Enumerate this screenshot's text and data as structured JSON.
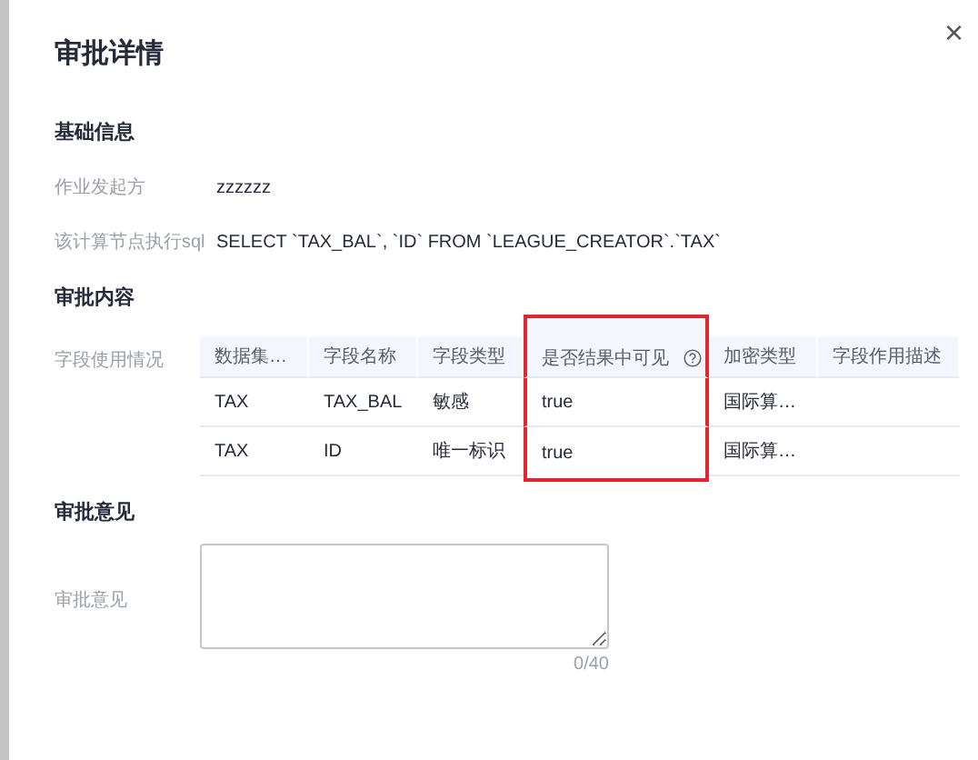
{
  "dialog": {
    "title": "审批详情",
    "close": "×"
  },
  "basic_info": {
    "heading": "基础信息",
    "fields": [
      {
        "label": "作业发起方",
        "value": "zzzzzz"
      },
      {
        "label": "该计算节点执行sql",
        "value": "SELECT `TAX_BAL`, `ID` FROM `LEAGUE_CREATOR`.`TAX`"
      }
    ]
  },
  "approval_content": {
    "heading": "审批内容",
    "label": "字段使用情况",
    "table": {
      "columns": [
        {
          "label": "数据集…",
          "highlighted": false,
          "help": false
        },
        {
          "label": "字段名称",
          "highlighted": false,
          "help": false
        },
        {
          "label": "字段类型",
          "highlighted": false,
          "help": false
        },
        {
          "label": "是否结果中可见",
          "highlighted": true,
          "help": true
        },
        {
          "label": "加密类型",
          "highlighted": false,
          "help": false
        },
        {
          "label": "字段作用描述",
          "highlighted": false,
          "help": false
        }
      ],
      "rows": [
        [
          "TAX",
          "TAX_BAL",
          "敏感",
          "true",
          "国际算…",
          ""
        ],
        [
          "TAX",
          "ID",
          "唯一标识",
          "true",
          "国际算…",
          ""
        ]
      ]
    }
  },
  "approval_opinion": {
    "heading": "审批意见",
    "label": "审批意见",
    "counter": "0/40"
  }
}
